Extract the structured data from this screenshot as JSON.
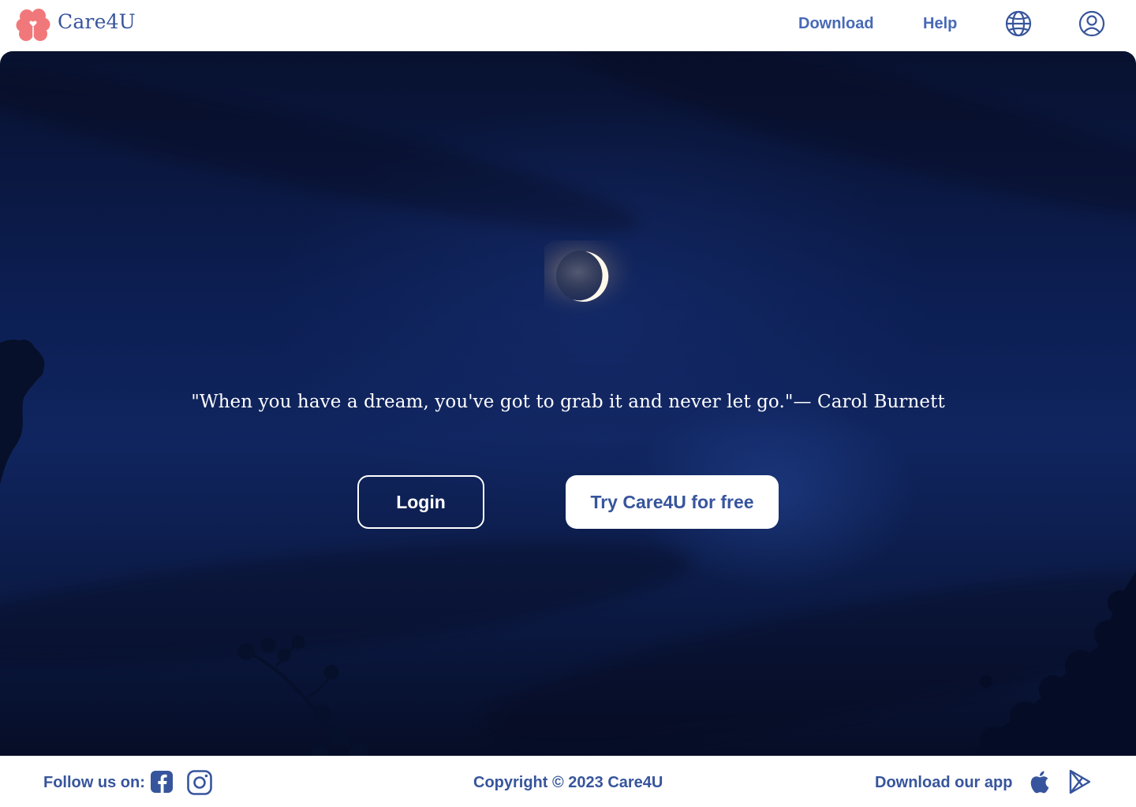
{
  "brand": {
    "name": "Care4U",
    "logo_icon": "brain-heart-icon",
    "logo_color": "#f1787a",
    "color": "#37559c"
  },
  "nav": {
    "download_label": "Download",
    "help_label": "Help",
    "language_icon": "globe-icon",
    "account_icon": "user-circle-icon",
    "link_color": "#4769b7"
  },
  "hero": {
    "quote": "\"When you have a dream, you've got to grab it and never let go.\"— Carol Burnett",
    "login_label": "Login",
    "try_label": "Try Care4U for free",
    "sky_color": "#0c1e52"
  },
  "footer": {
    "follow_label": "Follow us on:",
    "social_icons": [
      "facebook-icon",
      "instagram-icon"
    ],
    "copyright": "Copyright  © 2023 Care4U",
    "download_app_label": "Download our app",
    "store_icons": [
      "apple-icon",
      "google-play-icon"
    ],
    "text_color": "#37559c"
  }
}
